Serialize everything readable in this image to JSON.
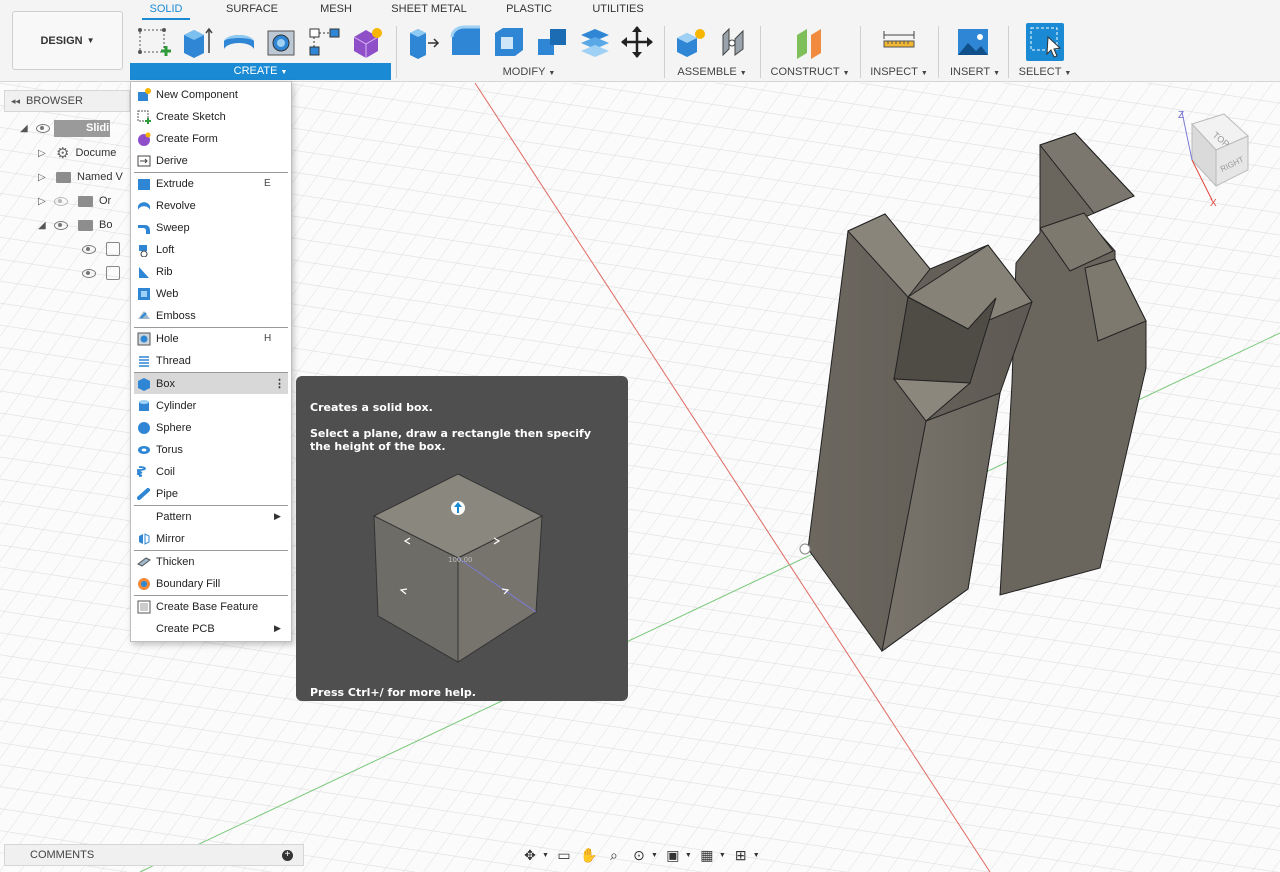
{
  "workspace": {
    "label": "DESIGN"
  },
  "tabs": [
    {
      "label": "SOLID",
      "active": true
    },
    {
      "label": "SURFACE",
      "active": false
    },
    {
      "label": "MESH",
      "active": false
    },
    {
      "label": "SHEET METAL",
      "active": false
    },
    {
      "label": "PLASTIC",
      "active": false
    },
    {
      "label": "UTILITIES",
      "active": false
    }
  ],
  "groups": {
    "create": "CREATE",
    "modify": "MODIFY",
    "assemble": "ASSEMBLE",
    "construct": "CONSTRUCT",
    "inspect": "INSPECT",
    "insert": "INSERT",
    "select": "SELECT"
  },
  "browser": {
    "title": "BROWSER",
    "rows": [
      {
        "label": "Slidin"
      },
      {
        "label": "Docume"
      },
      {
        "label": "Named V"
      },
      {
        "label": "Or"
      },
      {
        "label": "Bo"
      }
    ]
  },
  "create_menu": {
    "items": [
      {
        "label": "New Component",
        "shortcut": "",
        "icon": "new-component-icon"
      },
      {
        "label": "Create Sketch",
        "shortcut": "",
        "icon": "create-sketch-icon"
      },
      {
        "label": "Create Form",
        "shortcut": "",
        "icon": "create-form-icon"
      },
      {
        "label": "Derive",
        "shortcut": "",
        "icon": "derive-icon"
      },
      {
        "label": "Extrude",
        "shortcut": "E",
        "icon": "extrude-icon"
      },
      {
        "label": "Revolve",
        "shortcut": "",
        "icon": "revolve-icon"
      },
      {
        "label": "Sweep",
        "shortcut": "",
        "icon": "sweep-icon"
      },
      {
        "label": "Loft",
        "shortcut": "",
        "icon": "loft-icon"
      },
      {
        "label": "Rib",
        "shortcut": "",
        "icon": "rib-icon"
      },
      {
        "label": "Web",
        "shortcut": "",
        "icon": "web-icon"
      },
      {
        "label": "Emboss",
        "shortcut": "",
        "icon": "emboss-icon"
      },
      {
        "label": "Hole",
        "shortcut": "H",
        "icon": "hole-icon"
      },
      {
        "label": "Thread",
        "shortcut": "",
        "icon": "thread-icon"
      },
      {
        "label": "Box",
        "shortcut": "",
        "icon": "box-icon",
        "highlighted": true
      },
      {
        "label": "Cylinder",
        "shortcut": "",
        "icon": "cylinder-icon"
      },
      {
        "label": "Sphere",
        "shortcut": "",
        "icon": "sphere-icon"
      },
      {
        "label": "Torus",
        "shortcut": "",
        "icon": "torus-icon"
      },
      {
        "label": "Coil",
        "shortcut": "",
        "icon": "coil-icon"
      },
      {
        "label": "Pipe",
        "shortcut": "",
        "icon": "pipe-icon"
      },
      {
        "label": "Pattern",
        "shortcut": "",
        "icon": "",
        "submenu": true
      },
      {
        "label": "Mirror",
        "shortcut": "",
        "icon": "mirror-icon"
      },
      {
        "label": "Thicken",
        "shortcut": "",
        "icon": "thicken-icon"
      },
      {
        "label": "Boundary Fill",
        "shortcut": "",
        "icon": "boundary-fill-icon"
      },
      {
        "label": "Create Base Feature",
        "shortcut": "",
        "icon": "base-feature-icon"
      },
      {
        "label": "Create PCB",
        "shortcut": "",
        "icon": "",
        "submenu": true
      }
    ]
  },
  "tooltip": {
    "title": "Creates a solid box.",
    "body": "Select a plane, draw a rectangle then specify the height of the box.",
    "footer": "Press Ctrl+/ for more help.",
    "dimension": "100.00"
  },
  "viewcube": {
    "top": "TOP",
    "right": "RIGHT",
    "axis_z": "Z",
    "axis_x": "X"
  },
  "comments": {
    "title": "COMMENTS"
  },
  "colors": {
    "accent": "#1a8ad4",
    "model": "#6f6a62",
    "axis_red": "#e0443a",
    "axis_green": "#5cc05c"
  }
}
